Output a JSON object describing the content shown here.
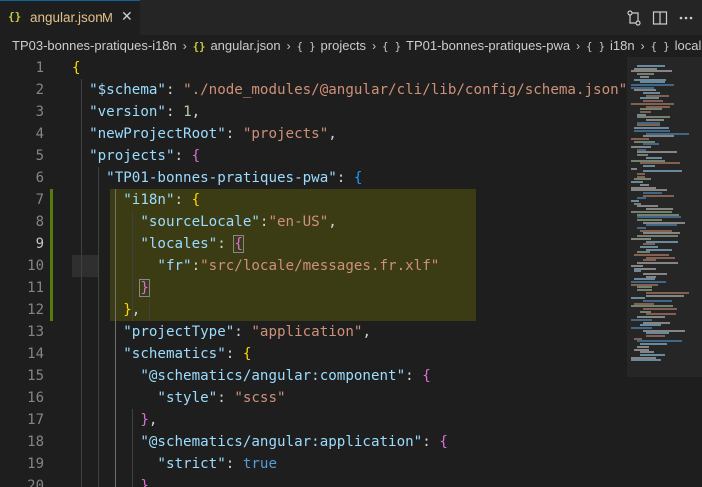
{
  "tab": {
    "icon": "{}",
    "filename": "angular.json",
    "modified": "M",
    "close": "✕"
  },
  "toolbar": {
    "open_changes": "compare-changes-icon",
    "split_editor": "split-editor-icon",
    "more_actions": "more-actions-icon"
  },
  "breadcrumb": {
    "items": [
      {
        "label": "TP03-bonnes-pratiques-i18n",
        "icon": ""
      },
      {
        "label": "angular.json",
        "icon": "{}"
      },
      {
        "label": "projects",
        "icon": "{ }"
      },
      {
        "label": "TP01-bonnes-pratiques-pwa",
        "icon": "{ }"
      },
      {
        "label": "i18n",
        "icon": "{ }"
      },
      {
        "label": "locales",
        "icon": "{ }"
      }
    ],
    "separator": "›"
  },
  "editor": {
    "line_numbers": [
      "1",
      "2",
      "3",
      "4",
      "5",
      "6",
      "7",
      "8",
      "9",
      "10",
      "11",
      "12",
      "13",
      "14",
      "15",
      "16",
      "17",
      "18",
      "19",
      "20"
    ],
    "active_line": "9",
    "lines": [
      [
        {
          "t": "{",
          "c": "br1"
        }
      ],
      [
        {
          "t": "  \"$schema\"",
          "c": "k"
        },
        {
          "t": ": ",
          "c": "p"
        },
        {
          "t": "\"./node_modules/@angular/cli/lib/config/schema.json\"",
          "c": "s"
        },
        {
          "t": ",",
          "c": "p"
        }
      ],
      [
        {
          "t": "  \"version\"",
          "c": "k"
        },
        {
          "t": ": ",
          "c": "p"
        },
        {
          "t": "1",
          "c": "n"
        },
        {
          "t": ",",
          "c": "p"
        }
      ],
      [
        {
          "t": "  \"newProjectRoot\"",
          "c": "k"
        },
        {
          "t": ": ",
          "c": "p"
        },
        {
          "t": "\"projects\"",
          "c": "s"
        },
        {
          "t": ",",
          "c": "p"
        }
      ],
      [
        {
          "t": "  \"projects\"",
          "c": "k"
        },
        {
          "t": ": ",
          "c": "p"
        },
        {
          "t": "{",
          "c": "br2"
        }
      ],
      [
        {
          "t": "    \"TP01-bonnes-pratiques-pwa\"",
          "c": "k"
        },
        {
          "t": ": ",
          "c": "p"
        },
        {
          "t": "{",
          "c": "br3"
        }
      ],
      [
        {
          "t": "      \"i18n\"",
          "c": "k"
        },
        {
          "t": ": ",
          "c": "p"
        },
        {
          "t": "{",
          "c": "br1"
        }
      ],
      [
        {
          "t": "        \"sourceLocale\"",
          "c": "k"
        },
        {
          "t": ":",
          "c": "p"
        },
        {
          "t": "\"en-US\"",
          "c": "s"
        },
        {
          "t": ",",
          "c": "p"
        }
      ],
      [
        {
          "t": "        \"locales\"",
          "c": "k"
        },
        {
          "t": ": ",
          "c": "p"
        },
        {
          "t": "{",
          "c": "br2 bm"
        }
      ],
      [
        {
          "t": "          \"fr\"",
          "c": "k"
        },
        {
          "t": ":",
          "c": "p"
        },
        {
          "t": "\"src/locale/messages.fr.xlf\"",
          "c": "s"
        }
      ],
      [
        {
          "t": "        ",
          "c": "p"
        },
        {
          "t": "}",
          "c": "br2 bm"
        }
      ],
      [
        {
          "t": "      ",
          "c": "p"
        },
        {
          "t": "}",
          "c": "br1"
        },
        {
          "t": ",",
          "c": "p"
        }
      ],
      [
        {
          "t": "      \"projectType\"",
          "c": "k"
        },
        {
          "t": ": ",
          "c": "p"
        },
        {
          "t": "\"application\"",
          "c": "s"
        },
        {
          "t": ",",
          "c": "p"
        }
      ],
      [
        {
          "t": "      \"schematics\"",
          "c": "k"
        },
        {
          "t": ": ",
          "c": "p"
        },
        {
          "t": "{",
          "c": "br1"
        }
      ],
      [
        {
          "t": "        \"@schematics/angular:component\"",
          "c": "k"
        },
        {
          "t": ": ",
          "c": "p"
        },
        {
          "t": "{",
          "c": "br2"
        }
      ],
      [
        {
          "t": "          \"style\"",
          "c": "k"
        },
        {
          "t": ": ",
          "c": "p"
        },
        {
          "t": "\"scss\"",
          "c": "s"
        }
      ],
      [
        {
          "t": "        ",
          "c": "p"
        },
        {
          "t": "}",
          "c": "br2"
        },
        {
          "t": ",",
          "c": "p"
        }
      ],
      [
        {
          "t": "        \"@schematics/angular:application\"",
          "c": "k"
        },
        {
          "t": ": ",
          "c": "p"
        },
        {
          "t": "{",
          "c": "br2"
        }
      ],
      [
        {
          "t": "          \"strict\"",
          "c": "k"
        },
        {
          "t": ": ",
          "c": "p"
        },
        {
          "t": "true",
          "c": "b"
        }
      ],
      [
        {
          "t": "        ",
          "c": "p"
        },
        {
          "t": "}",
          "c": "br2"
        }
      ]
    ]
  },
  "colors": {
    "background": "#1e1e1e",
    "tabbar": "#252526",
    "key": "#9cdcfe",
    "string": "#ce9178",
    "number": "#b5cea8",
    "boolean": "#569cd6",
    "modified": "#e2c08d",
    "git_added": "#587c0c"
  }
}
